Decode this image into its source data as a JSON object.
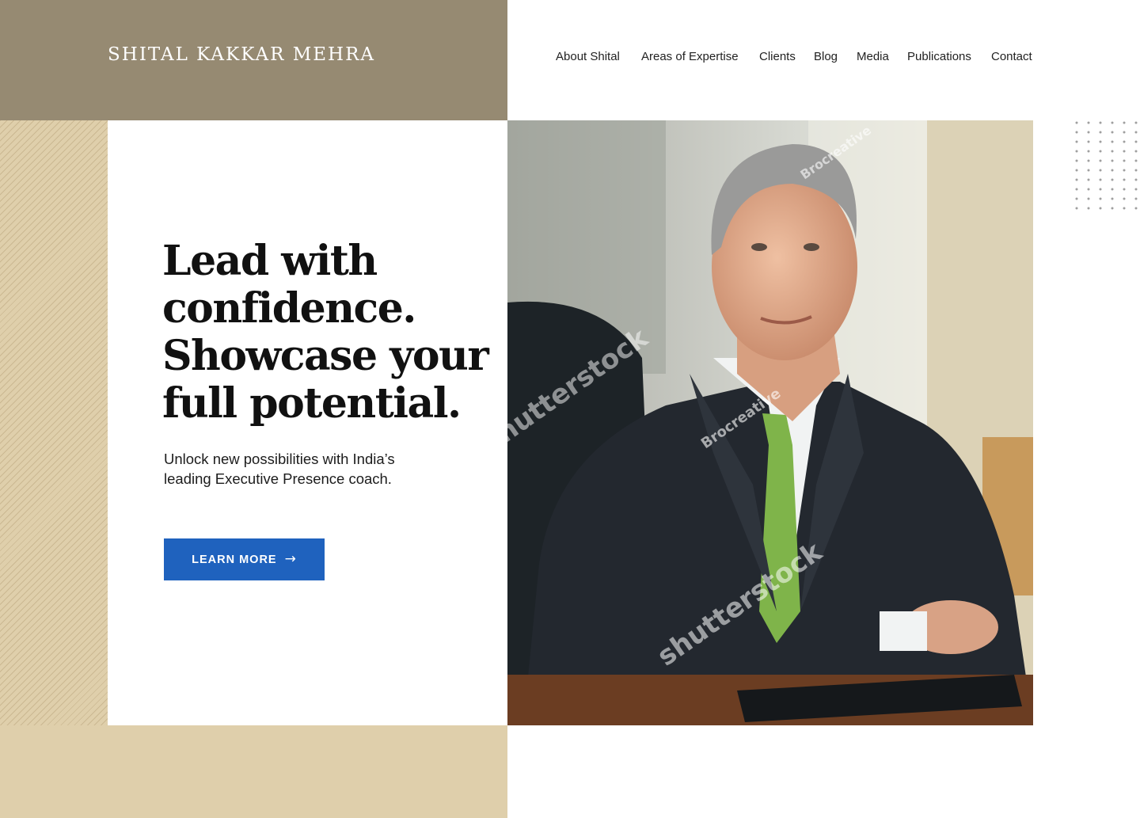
{
  "brand": {
    "name": "SHITAL KAKKAR MEHRA"
  },
  "nav": {
    "items": [
      {
        "label": "About Shital"
      },
      {
        "label": "Areas of Expertise"
      },
      {
        "label": "Clients"
      },
      {
        "label": "Blog"
      },
      {
        "label": "Media"
      },
      {
        "label": "Publications"
      },
      {
        "label": "Contact"
      }
    ]
  },
  "hero": {
    "title_lines": [
      "Lead with",
      "confidence.",
      "Showcase your",
      "full potential."
    ],
    "subtitle_lines": [
      "Unlock new possibilities with India’s",
      "leading Executive Presence coach."
    ],
    "cta_label": "LEARN MORE",
    "cta_icon": "arrow-right-icon"
  },
  "photo": {
    "subject": "man-in-suit-at-desk",
    "watermarks": [
      "shutterstock",
      "Brocreative"
    ]
  },
  "colors": {
    "brand_block": "#968a72",
    "tan": "#dfcfab",
    "button": "#1f62be",
    "heading": "#111111"
  }
}
